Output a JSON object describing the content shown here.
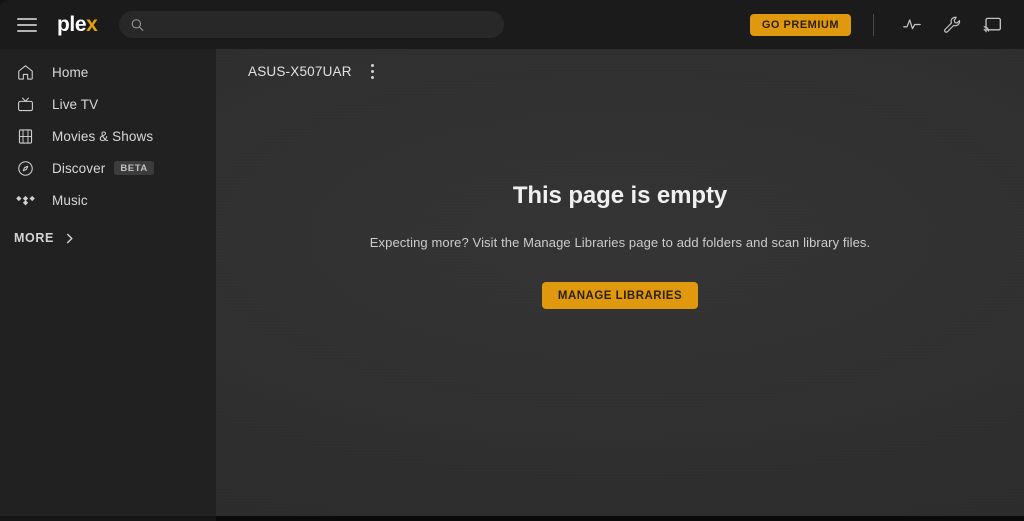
{
  "app": {
    "name": "Plex",
    "logo_text_main": "ple",
    "logo_text_accent": "x",
    "accent_color": "#e5a00d",
    "button_color": "#e0990f",
    "sidebar_bg": "#212121",
    "topbar_bg": "#1b1b1b",
    "content_bg": "#303030"
  },
  "topbar": {
    "menu_icon": "hamburger-icon",
    "search": {
      "value": "",
      "placeholder": "",
      "icon": "search-icon"
    },
    "go_premium_label": "GO PREMIUM",
    "actions": [
      {
        "name": "activity-icon",
        "label": "Activity"
      },
      {
        "name": "wrench-icon",
        "label": "Settings"
      },
      {
        "name": "cast-icon",
        "label": "Cast"
      }
    ]
  },
  "sidebar": {
    "items": [
      {
        "label": "Home",
        "icon": "home-icon",
        "badge": ""
      },
      {
        "label": "Live TV",
        "icon": "tv-icon",
        "badge": ""
      },
      {
        "label": "Movies & Shows",
        "icon": "film-icon",
        "badge": ""
      },
      {
        "label": "Discover",
        "icon": "compass-icon",
        "badge": "BETA"
      },
      {
        "label": "Music",
        "icon": "music-icon",
        "badge": ""
      }
    ],
    "more_label": "MORE"
  },
  "content": {
    "breadcrumb": "ASUS-X507UAR",
    "kebab_icon": "more-vertical-icon",
    "empty_title": "This page is empty",
    "empty_subtitle": "Expecting more? Visit the Manage Libraries page to add folders and scan library files.",
    "manage_libraries_label": "MANAGE LIBRARIES"
  }
}
